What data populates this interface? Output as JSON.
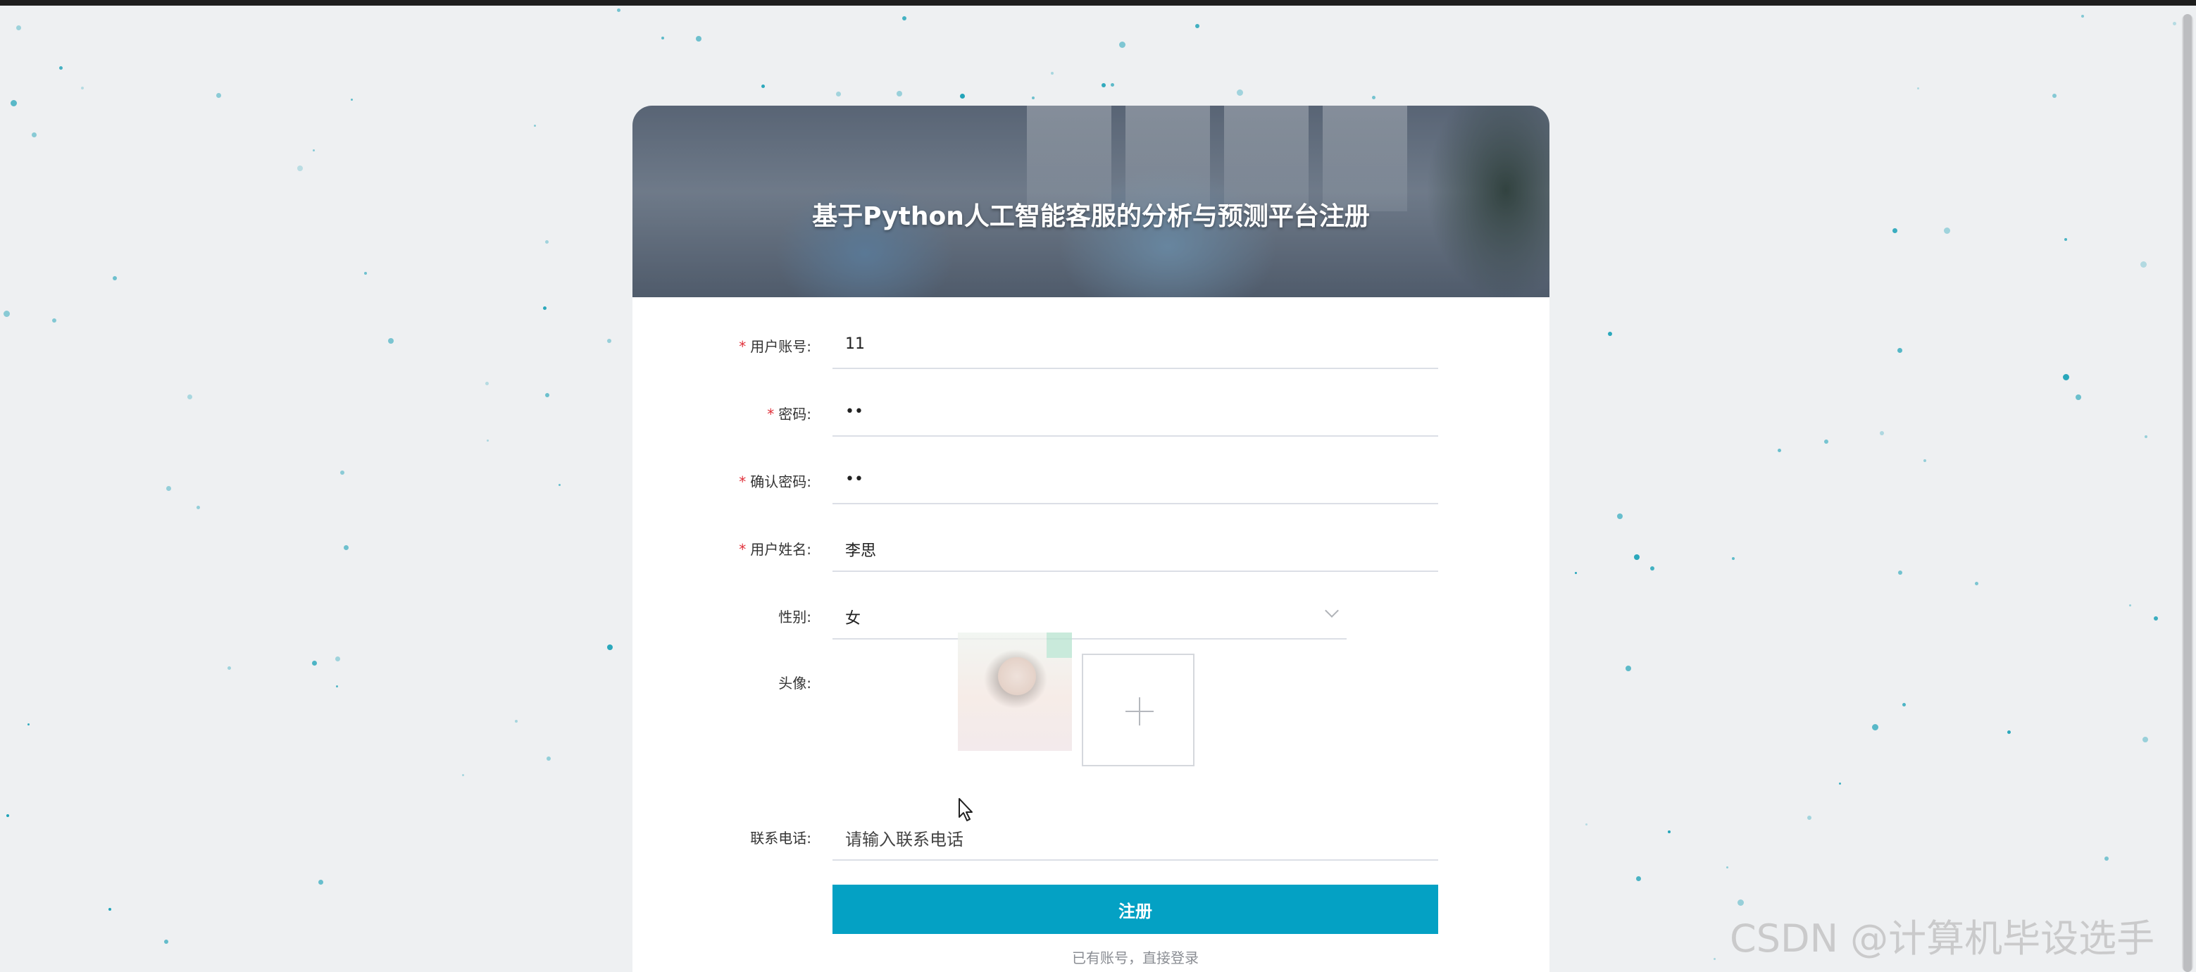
{
  "page": {
    "title": "基于Python人工智能客服的分析与预测平台注册",
    "watermark": "CSDN @计算机毕设选手"
  },
  "form": {
    "account": {
      "label": "用户账号:",
      "value": "11",
      "required": true
    },
    "password": {
      "label": "密码:",
      "value": "••",
      "required": true
    },
    "confirm_password": {
      "label": "确认密码:",
      "value": "••",
      "required": true
    },
    "name": {
      "label": "用户姓名:",
      "value": "李思",
      "required": true
    },
    "gender": {
      "label": "性别:",
      "value": "女"
    },
    "avatar": {
      "label": "头像:"
    },
    "phone": {
      "label": "联系电话:",
      "placeholder": "请输入联系电话"
    },
    "required_mark": "*"
  },
  "actions": {
    "submit_label": "注册",
    "login_link": "已有账号，直接登录"
  },
  "colors": {
    "accent": "#04a1c4",
    "required": "#e0303a",
    "dots": "#1fa3b8"
  }
}
